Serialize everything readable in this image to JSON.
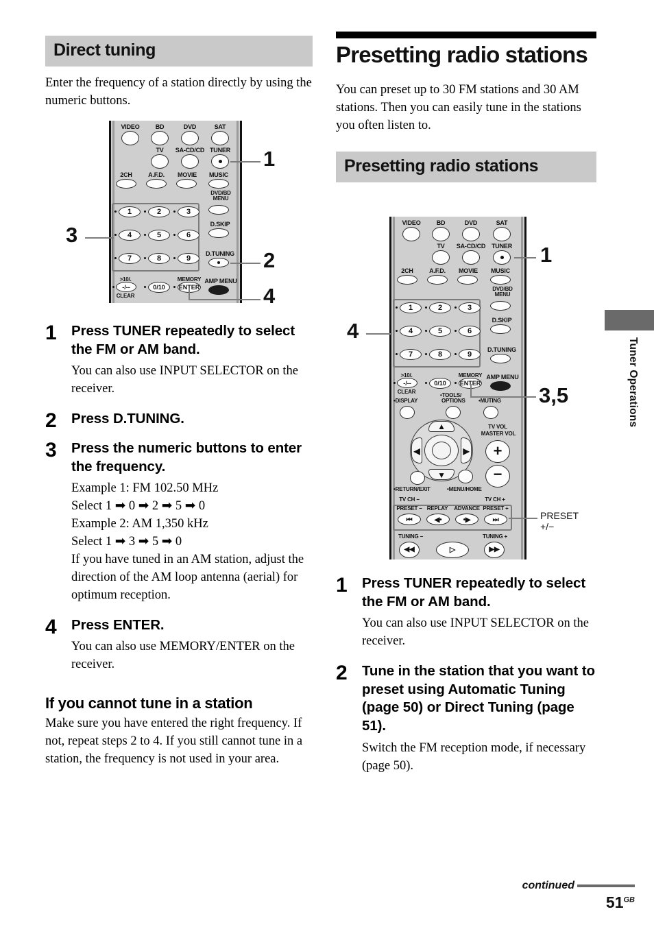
{
  "page": {
    "number": "51",
    "region_suffix": "GB",
    "continued_label": "continued",
    "side_tab_label": "Tuner Operations"
  },
  "left_column": {
    "section_header": "Direct tuning",
    "intro": "Enter the frequency of a station directly by using the numeric buttons.",
    "steps": [
      {
        "num": "1",
        "title": "Press TUNER repeatedly to select the FM or AM band.",
        "sub": "You can also use INPUT SELECTOR on the receiver."
      },
      {
        "num": "2",
        "title": "Press D.TUNING.",
        "sub": ""
      },
      {
        "num": "3",
        "title": "Press the numeric buttons to enter the frequency.",
        "sub_lines": [
          "Example 1: FM 102.50 MHz",
          "Select 1 ➡ 0 ➡ 2 ➡ 5 ➡ 0",
          "Example 2: AM 1,350 kHz",
          "Select 1 ➡ 3 ➡ 5 ➡ 0",
          "If you have tuned in an AM station, adjust the direction of the AM loop antenna (aerial) for optimum reception."
        ]
      },
      {
        "num": "4",
        "title": "Press ENTER.",
        "sub": "You can also use MEMORY/ENTER on the receiver."
      }
    ],
    "sub_head": "If you cannot tune in a station",
    "sub_body": "Make sure you have entered the right frequency. If not, repeat steps 2 to 4. If you still cannot tune in a station, the frequency is not used in your area."
  },
  "right_column": {
    "chapter_title": "Presetting radio stations",
    "intro": "You can preset up to 30 FM stations and 30 AM stations. Then you can easily tune in the stations you often listen to.",
    "section_header": "Presetting radio stations",
    "steps": [
      {
        "num": "1",
        "title": "Press TUNER repeatedly to select the FM or AM band.",
        "sub": "You can also use INPUT SELECTOR on the receiver."
      },
      {
        "num": "2",
        "title": "Tune in the station that you want to preset using Automatic Tuning (page 50) or Direct Tuning (page 51).",
        "sub": "Switch the FM reception mode, if necessary (page 50)."
      }
    ]
  },
  "remote_left": {
    "callouts": [
      {
        "id": "c1",
        "label": "1"
      },
      {
        "id": "c2",
        "label": "2"
      },
      {
        "id": "c3",
        "label": "3"
      },
      {
        "id": "c4",
        "label": "4"
      }
    ],
    "input_row1": [
      "VIDEO",
      "BD",
      "DVD",
      "SAT"
    ],
    "input_row2": [
      "TV",
      "SA-CD/CD",
      "TUNER"
    ],
    "mode_row": [
      "2CH",
      "A.F.D.",
      "MOVIE",
      "MUSIC"
    ],
    "right_side": [
      "DVD/BD MENU",
      "D.SKIP",
      "D.TUNING",
      "AMP MENU"
    ],
    "keypad": [
      "1",
      "2",
      "3",
      "4",
      "5",
      "6",
      "7",
      "8",
      "9"
    ],
    "bottom_row": [
      ">10/.",
      "-/--",
      "CLEAR",
      "0/10",
      "MEMORY",
      "ENTER"
    ]
  },
  "remote_right": {
    "callouts": [
      {
        "id": "c1",
        "label": "1"
      },
      {
        "id": "c4",
        "label": "4"
      },
      {
        "id": "c35",
        "label": "3,5"
      }
    ],
    "preset_callout": {
      "line1": "PRESET",
      "line2": "+/−"
    },
    "input_row1": [
      "VIDEO",
      "BD",
      "DVD",
      "SAT"
    ],
    "input_row2": [
      "TV",
      "SA-CD/CD",
      "TUNER"
    ],
    "mode_row": [
      "2CH",
      "A.F.D.",
      "MOVIE",
      "MUSIC"
    ],
    "right_side": [
      "DVD/BD MENU",
      "D.SKIP",
      "D.TUNING",
      "AMP MENU"
    ],
    "keypad": [
      "1",
      "2",
      "3",
      "4",
      "5",
      "6",
      "7",
      "8",
      "9"
    ],
    "bottom_row": [
      ">10/.",
      "-/--",
      "CLEAR",
      "0/10",
      "MEMORY",
      "ENTER"
    ],
    "fn_row": [
      "DISPLAY",
      "TOOLS/ OPTIONS",
      "MUTING"
    ],
    "vol_label": [
      "TV VOL",
      "MASTER VOL"
    ],
    "nav_labels": [
      "RETURN/EXIT",
      "MENU/HOME"
    ],
    "transport": {
      "tv_ch_minus": "TV CH −",
      "tv_ch_plus": "TV CH +",
      "preset_minus": "PRESET −",
      "replay": "REPLAY",
      "advance": "ADVANCE",
      "preset_plus": "PRESET +",
      "tuning_minus": "TUNING −",
      "tuning_plus": "TUNING +"
    }
  },
  "colors": {
    "header_bar": "#c9c9c9",
    "remote_body": "#cfcfcf",
    "leader": "#7d7d7d",
    "side_tab": "#6a6a6a"
  }
}
